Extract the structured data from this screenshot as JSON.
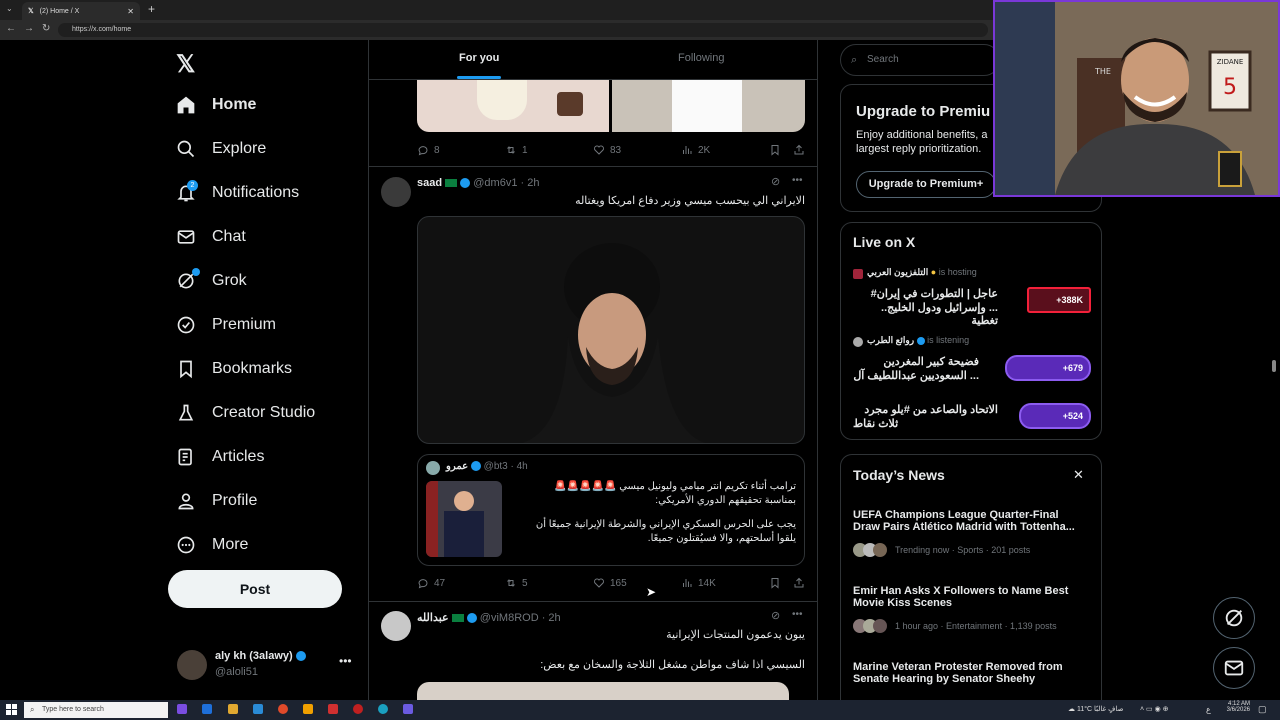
{
  "browser": {
    "tab_title": "(2) Home / X",
    "url": "https://x.com/home"
  },
  "sidebar": {
    "items": [
      {
        "label": "Home"
      },
      {
        "label": "Explore"
      },
      {
        "label": "Notifications",
        "badge": "2"
      },
      {
        "label": "Chat"
      },
      {
        "label": "Grok"
      },
      {
        "label": "Premium"
      },
      {
        "label": "Bookmarks"
      },
      {
        "label": "Creator Studio"
      },
      {
        "label": "Articles"
      },
      {
        "label": "Profile"
      },
      {
        "label": "More"
      }
    ],
    "post_label": "Post",
    "account": {
      "name": "aly kh (3alawy)",
      "handle": "@aloli51"
    }
  },
  "main": {
    "tabs": [
      "For you",
      "Following"
    ],
    "post0": {
      "replies": "8",
      "reposts": "1",
      "likes": "83",
      "views": "2K"
    },
    "post1": {
      "name": "saad",
      "handle": "@dm6v1",
      "time": "· 2h",
      "text": "الايراني الي بيحسب ميسي وزير دفاع امريكا ويغتاله",
      "quote": {
        "name": "عمرو",
        "handle": "@bt3",
        "time": "· 4h",
        "line1": "ترامب أثناء تكريم انتر ميامي وليونيل ميسي",
        "line2": "بمناسبة تحقيقهم الدوري الأمريكي:",
        "line3": "يجب على الحرس العسكري الإيراني والشرطة الإيرانية جميعًا أن",
        "line4": "يلقوا أسلحتهم، والا فسيُقتلون جميعًا."
      },
      "replies": "47",
      "reposts": "5",
      "likes": "165",
      "views": "14K"
    },
    "post2": {
      "name": "عبدالله",
      "handle": "@viM8ROD",
      "time": "· 2h",
      "text1": "يبون يدعمون المنتجات الإيرانية",
      "text2": "السيسي اذا شاف مواطن مشغل الثلاجة والسخان مع بعض:"
    }
  },
  "right": {
    "search_placeholder": "Search",
    "premium": {
      "title": "Upgrade to Premiu",
      "desc1": "Enjoy additional benefits, a",
      "desc2": "largest reply prioritization.",
      "button": "Upgrade to Premium+"
    },
    "live": {
      "title": "Live on X",
      "items": [
        {
          "host": "التلفزيون العربي",
          "status": "is hosting",
          "line1": "عاجل | التطورات في إيران#",
          "line2": "... وإسرائيل ودول الخليج.. تغطية",
          "count": "+388K"
        },
        {
          "host": "روائع الطرب",
          "status": "is listening",
          "line1": "فضيحة كبير المغردين",
          "line2": "... السعوديين عبداللطيف آل",
          "count": "+679"
        },
        {
          "host": "",
          "status": "",
          "line1": "الاتحاد والصاعد من #يلو مجرد",
          "line2": "ثلاث نقاط",
          "count": "+524"
        }
      ]
    },
    "news": {
      "title": "Today’s News",
      "items": [
        {
          "title1": "UEFA Champions League Quarter-Final",
          "title2": "Draw Pairs Atlético Madrid with Tottenha...",
          "meta": "Trending now · Sports · 201 posts"
        },
        {
          "title1": "Emir Han Asks X Followers to Name Best",
          "title2": "Movie Kiss Scenes",
          "meta": "1 hour ago · Entertainment · 1,139 posts"
        },
        {
          "title1": "Marine Veteran Protester Removed from",
          "title2": "Senate Hearing by Senator Sheehy",
          "meta": ""
        }
      ]
    }
  },
  "webcam": {
    "poster_text": "ZIDANE",
    "poster_number": "5",
    "sign_text": "THE"
  },
  "taskbar": {
    "search_placeholder": "Type here to search",
    "weather": "11°C صافٍ غالبًا",
    "time": "4:12 AM",
    "date": "3/6/2026",
    "lang": "ع"
  },
  "colors": {
    "accent": "#1d9bf0",
    "background": "#000000",
    "border": "#2f3336",
    "webcam_border": "#7a38d8"
  }
}
